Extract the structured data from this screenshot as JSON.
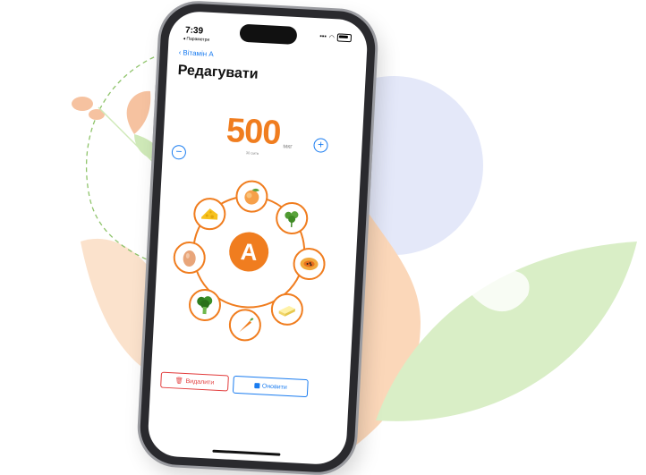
{
  "colors": {
    "accent": "#f07d1f",
    "link": "#1a7cf0",
    "danger": "#e23b3b",
    "leaf_green": "#cfe9b8",
    "peach": "#fbd7b9",
    "lavender": "#e4e8f9"
  },
  "status_bar": {
    "time": "7:39",
    "back_app": "◂ Параметри"
  },
  "nav": {
    "back_label": "Вітамін А"
  },
  "page": {
    "title": "Редагувати"
  },
  "amount": {
    "value": "500",
    "sub_caption": "30 смтв",
    "unit": "мкг",
    "minus_icon": "minus-circle-icon",
    "plus_icon": "plus-circle-icon"
  },
  "vitamin": {
    "letter": "A"
  },
  "foods": [
    "peach",
    "parsley",
    "papaya",
    "butter",
    "carrot",
    "broccoli",
    "egg",
    "cheese"
  ],
  "actions": {
    "delete_label": "Видалити",
    "update_label": "Оновити",
    "delete_icon": "trash-icon",
    "update_icon": "save-icon"
  }
}
